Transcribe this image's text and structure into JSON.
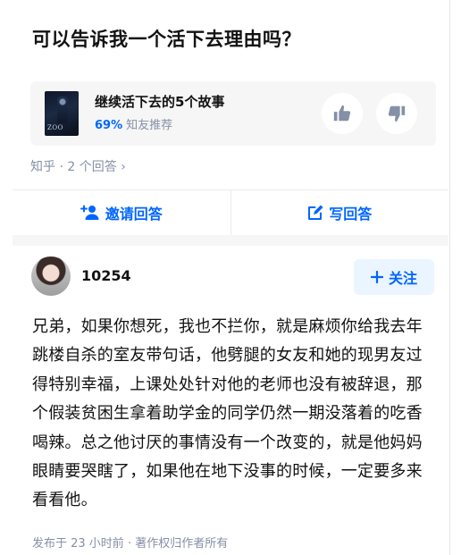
{
  "question": {
    "title": "可以告诉我一个活下去理由吗？"
  },
  "book_card": {
    "cover_text": "ZOO",
    "title": "继续活下去的5个故事",
    "rating_percent": "69%",
    "rating_label": "知友推荐",
    "upvote_icon": "thumbs-up-icon",
    "downvote_icon": "thumbs-down-icon"
  },
  "meta": {
    "text": "知乎 · 2 个回答 ›"
  },
  "actions": {
    "invite_label": "邀请回答",
    "write_label": "写回答"
  },
  "answer": {
    "author": "10254",
    "follow_label": "关注",
    "body": "兄弟，如果你想死，我也不拦你，就是麻烦你给我去年跳楼自杀的室友带句话，他劈腿的女友和她的现男友过得特别幸福，上课处处针对他的老师也没有被辞退，那个假装贫困生拿着助学金的同学仍然一期没落着的吃香喝辣。总之他讨厌的事情没有一个改变的，就是他妈妈眼睛要哭瞎了，如果他在地下没事的时候，一定要多来看看他。",
    "footer": "发布于 23 小时前 · 著作权归作者所有"
  },
  "colors": {
    "accent": "#0066ff",
    "muted": "#8590a6",
    "card_bg": "#f6f6f6"
  }
}
